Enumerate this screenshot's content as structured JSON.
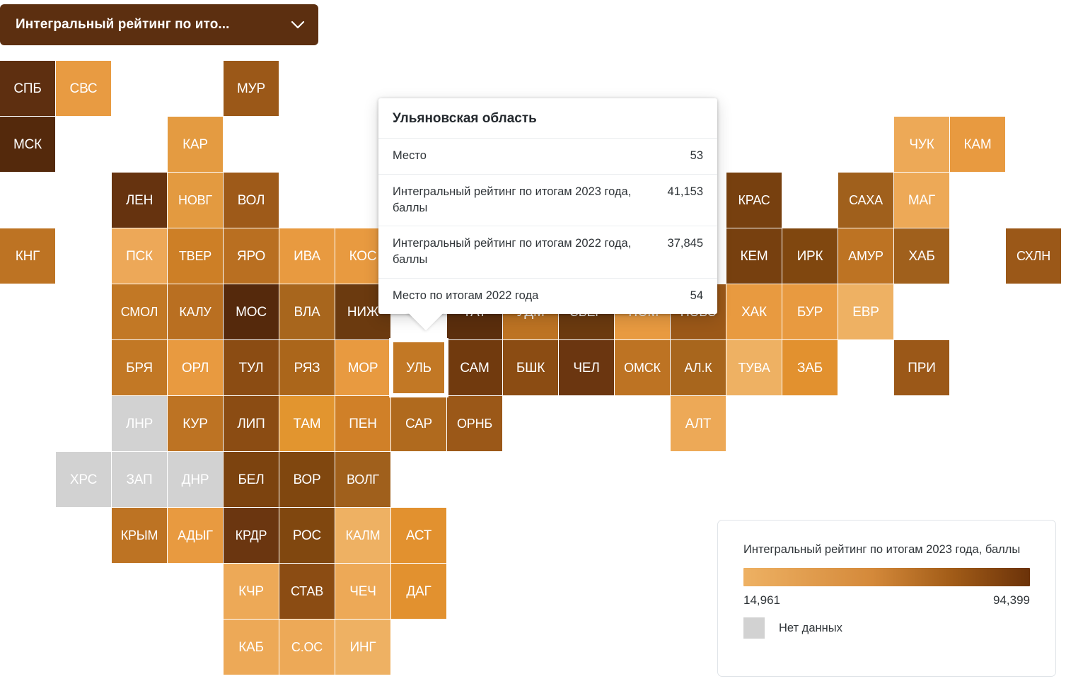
{
  "selector": {
    "label": "Интегральный рейтинг по ито...",
    "icon": "chevron-down-icon"
  },
  "tooltip": {
    "title": "Ульяновская область",
    "rows": [
      {
        "key": "Место",
        "value": "53"
      },
      {
        "key": "Интегральный рейтинг по итогам 2023 года, баллы",
        "value": "41,153"
      },
      {
        "key": "Интегральный рейтинг по итогам 2022 года, баллы",
        "value": "37,845"
      },
      {
        "key": "Место по итогам 2022 года",
        "value": "54"
      }
    ]
  },
  "legend": {
    "title": "Интегральный рейтинг по итогам 2023 года, баллы",
    "min_label": "14,961",
    "max_label": "94,399",
    "gradient_from": "#eeb163",
    "gradient_to": "#6b3209",
    "nodata_label": "Нет данных",
    "nodata_color": "#d2d2d2"
  },
  "chart_data": {
    "type": "heatmap",
    "title": "Интегральный рейтинг по итогам 2023 года, баллы",
    "xlabel": "",
    "ylabel": "",
    "grid": false,
    "legend_position": "bottom-right",
    "value_range": [
      14961,
      94399
    ],
    "colorscale": [
      "#eeb163",
      "#6b3209"
    ],
    "nodata_color": "#d2d2d2",
    "selected": "УЛЬ",
    "tiles": [
      {
        "label": "СПБ",
        "col": 0,
        "row": 0,
        "color": "#5e2f10"
      },
      {
        "label": "СВС",
        "col": 1,
        "row": 0,
        "color": "#e89b42"
      },
      {
        "label": "МУР",
        "col": 4,
        "row": 0,
        "color": "#9b5818"
      },
      {
        "label": "МСК",
        "col": 0,
        "row": 1,
        "color": "#54290c"
      },
      {
        "label": "КАР",
        "col": 3,
        "row": 1,
        "color": "#e49b41"
      },
      {
        "label": "ЛЕН",
        "col": 2,
        "row": 2,
        "color": "#66330f"
      },
      {
        "label": "НОВГ",
        "col": 3,
        "row": 2,
        "color": "#e39a40"
      },
      {
        "label": "ВОЛ",
        "col": 4,
        "row": 2,
        "color": "#9e5a19"
      },
      {
        "label": "КРАС",
        "col": 13,
        "row": 2,
        "color": "#77400f"
      },
      {
        "label": "САХА",
        "col": 15,
        "row": 2,
        "color": "#a0601c"
      },
      {
        "label": "МАГ",
        "col": 16,
        "row": 2,
        "color": "#eda957"
      },
      {
        "label": "ЧУК",
        "col": 16,
        "row": 1,
        "color": "#eda957"
      },
      {
        "label": "КАМ",
        "col": 17,
        "row": 1,
        "color": "#e89a40"
      },
      {
        "label": "КНГ",
        "col": 0,
        "row": 3,
        "color": "#bd7323"
      },
      {
        "label": "ПСК",
        "col": 2,
        "row": 3,
        "color": "#eda858"
      },
      {
        "label": "ТВЕР",
        "col": 3,
        "row": 3,
        "color": "#cd7f26"
      },
      {
        "label": "ЯРО",
        "col": 4,
        "row": 3,
        "color": "#b96f21"
      },
      {
        "label": "ИВА",
        "col": 5,
        "row": 3,
        "color": "#e89a40"
      },
      {
        "label": "КОС",
        "col": 6,
        "row": 3,
        "color": "#e89a40"
      },
      {
        "label": "КЕМ",
        "col": 13,
        "row": 3,
        "color": "#77400f"
      },
      {
        "label": "ИРК",
        "col": 14,
        "row": 3,
        "color": "#80470f"
      },
      {
        "label": "АМУР",
        "col": 15,
        "row": 3,
        "color": "#bd7323"
      },
      {
        "label": "ХАБ",
        "col": 16,
        "row": 3,
        "color": "#a0601c"
      },
      {
        "label": "СХЛН",
        "col": 18,
        "row": 3,
        "color": "#9b5818"
      },
      {
        "label": "СМОЛ",
        "col": 2,
        "row": 4,
        "color": "#c27825"
      },
      {
        "label": "КАЛУ",
        "col": 3,
        "row": 4,
        "color": "#b96f21"
      },
      {
        "label": "МОС",
        "col": 4,
        "row": 4,
        "color": "#55290c"
      },
      {
        "label": "ВЛА",
        "col": 5,
        "row": 4,
        "color": "#a8661d"
      },
      {
        "label": "НИЖ",
        "col": 6,
        "row": 4,
        "color": "#6b3a0f"
      },
      {
        "label": "ТАТ",
        "col": 8,
        "row": 4,
        "color": "#5b2e0d",
        "occluded": true
      },
      {
        "label": "УДМ",
        "col": 9,
        "row": 4,
        "color": "#bd7323",
        "occluded": true
      },
      {
        "label": "СВЕР",
        "col": 10,
        "row": 4,
        "color": "#6b3a0f",
        "occluded": true
      },
      {
        "label": "ТЮМ",
        "col": 11,
        "row": 4,
        "color": "#e89a40",
        "occluded": true
      },
      {
        "label": "НОВС",
        "col": 12,
        "row": 4,
        "color": "#9b5818",
        "occluded": true
      },
      {
        "label": "ХАК",
        "col": 13,
        "row": 4,
        "color": "#e89a40"
      },
      {
        "label": "БУР",
        "col": 14,
        "row": 4,
        "color": "#e89a40"
      },
      {
        "label": "ЕВР",
        "col": 15,
        "row": 4,
        "color": "#eeb163"
      },
      {
        "label": "БРЯ",
        "col": 2,
        "row": 5,
        "color": "#c27825"
      },
      {
        "label": "ОРЛ",
        "col": 3,
        "row": 5,
        "color": "#e89a40"
      },
      {
        "label": "ТУЛ",
        "col": 4,
        "row": 5,
        "color": "#8b4c13"
      },
      {
        "label": "РЯЗ",
        "col": 5,
        "row": 5,
        "color": "#ab661b"
      },
      {
        "label": "МОР",
        "col": 6,
        "row": 5,
        "color": "#e89a40"
      },
      {
        "label": "УЛЬ",
        "col": 7,
        "row": 5,
        "color": "#c27825",
        "selected": true
      },
      {
        "label": "САМ",
        "col": 8,
        "row": 5,
        "color": "#713a0e"
      },
      {
        "label": "БШК",
        "col": 9,
        "row": 5,
        "color": "#8b4c13"
      },
      {
        "label": "ЧЕЛ",
        "col": 10,
        "row": 5,
        "color": "#6b3610"
      },
      {
        "label": "ОМСК",
        "col": 11,
        "row": 5,
        "color": "#bd7323"
      },
      {
        "label": "АЛ.К",
        "col": 12,
        "row": 5,
        "color": "#a8661d"
      },
      {
        "label": "ТУВА",
        "col": 13,
        "row": 5,
        "color": "#eeb163"
      },
      {
        "label": "ЗАБ",
        "col": 14,
        "row": 5,
        "color": "#e2912f"
      },
      {
        "label": "ПРИ",
        "col": 16,
        "row": 5,
        "color": "#9b5818"
      },
      {
        "label": "ЛНР",
        "col": 2,
        "row": 6,
        "color": "#d2d2d2",
        "nodata": true
      },
      {
        "label": "КУР",
        "col": 3,
        "row": 6,
        "color": "#bd7323"
      },
      {
        "label": "ЛИП",
        "col": 4,
        "row": 6,
        "color": "#8b4c13"
      },
      {
        "label": "ТАМ",
        "col": 5,
        "row": 6,
        "color": "#e2952f"
      },
      {
        "label": "ПЕН",
        "col": 6,
        "row": 6,
        "color": "#d08028"
      },
      {
        "label": "САР",
        "col": 7,
        "row": 6,
        "color": "#b06a1e"
      },
      {
        "label": "ОРНБ",
        "col": 8,
        "row": 6,
        "color": "#9b5818"
      },
      {
        "label": "АЛТ",
        "col": 12,
        "row": 6,
        "color": "#eda957"
      },
      {
        "label": "ХРС",
        "col": 1,
        "row": 7,
        "color": "#d2d2d2",
        "nodata": true
      },
      {
        "label": "ЗАП",
        "col": 2,
        "row": 7,
        "color": "#d2d2d2",
        "nodata": true
      },
      {
        "label": "ДНР",
        "col": 3,
        "row": 7,
        "color": "#d2d2d2",
        "nodata": true
      },
      {
        "label": "БЕЛ",
        "col": 4,
        "row": 7,
        "color": "#7c430f"
      },
      {
        "label": "ВОР",
        "col": 5,
        "row": 7,
        "color": "#80470f"
      },
      {
        "label": "ВОЛГ",
        "col": 6,
        "row": 7,
        "color": "#a0601c"
      },
      {
        "label": "КРЫМ",
        "col": 2,
        "row": 8,
        "color": "#bd7323"
      },
      {
        "label": "АДЫГ",
        "col": 3,
        "row": 8,
        "color": "#e89a40"
      },
      {
        "label": "КРДР",
        "col": 4,
        "row": 8,
        "color": "#6b3610"
      },
      {
        "label": "РОС",
        "col": 5,
        "row": 8,
        "color": "#80470f"
      },
      {
        "label": "КАЛМ",
        "col": 6,
        "row": 8,
        "color": "#eeb163"
      },
      {
        "label": "АСТ",
        "col": 7,
        "row": 8,
        "color": "#e2912f"
      },
      {
        "label": "КЧР",
        "col": 4,
        "row": 9,
        "color": "#eda957"
      },
      {
        "label": "СТАВ",
        "col": 5,
        "row": 9,
        "color": "#8b4c13"
      },
      {
        "label": "ЧЕЧ",
        "col": 6,
        "row": 9,
        "color": "#eda957"
      },
      {
        "label": "ДАГ",
        "col": 7,
        "row": 9,
        "color": "#e2912f"
      },
      {
        "label": "КАБ",
        "col": 4,
        "row": 10,
        "color": "#eda957"
      },
      {
        "label": "С.ОС",
        "col": 5,
        "row": 10,
        "color": "#eda957"
      },
      {
        "label": "ИНГ",
        "col": 6,
        "row": 10,
        "color": "#eeb163"
      }
    ]
  }
}
